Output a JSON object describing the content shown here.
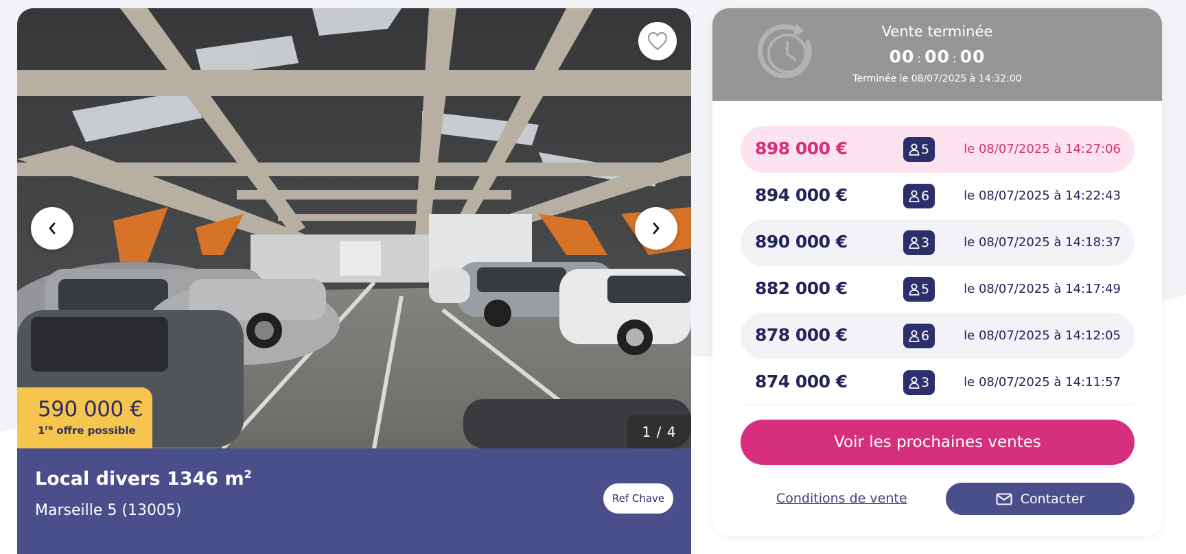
{
  "listing": {
    "price": "590 000 €",
    "offer_ord": "1",
    "offer_sup": "re",
    "offer_text": " offre possible",
    "counter": "1 / 4",
    "title": "Local divers 1346 m",
    "title_sup": "2",
    "address": "Marseille 5 (13005)",
    "ref_label": "Ref Chave"
  },
  "icons": {
    "favorite": "heart-outline-icon",
    "prev": "chevron-left-icon",
    "next": "chevron-right-icon",
    "clock": "clock-refresh-icon",
    "bidder": "person-icon",
    "mail": "envelope-icon"
  },
  "sale": {
    "status": "Vente terminée",
    "hours": "00",
    "minutes": "00",
    "seconds": "00",
    "ended_at": "Terminée le 08/07/2025 à 14:32:00",
    "bids": [
      {
        "amount": "898 000 €",
        "bidders": "5",
        "time": "le 08/07/2025 à 14:27:06"
      },
      {
        "amount": "894 000 €",
        "bidders": "6",
        "time": "le 08/07/2025 à 14:22:43"
      },
      {
        "amount": "890 000 €",
        "bidders": "3",
        "time": "le 08/07/2025 à 14:18:37"
      },
      {
        "amount": "882 000 €",
        "bidders": "5",
        "time": "le 08/07/2025 à 14:17:49"
      },
      {
        "amount": "878 000 €",
        "bidders": "6",
        "time": "le 08/07/2025 à 14:12:05"
      },
      {
        "amount": "874 000 €",
        "bidders": "3",
        "time": "le 08/07/2025 à 14:11:57"
      }
    ],
    "cta_label": "Voir les prochaines ventes",
    "conditions_label": "Conditions de vente",
    "contact_label": "Contacter"
  },
  "colors": {
    "navy": "#22245a",
    "band": "#4a4e8b",
    "pink": "#d62f7d",
    "pink_light": "#fce3ef",
    "yellow": "#f5c54e",
    "header_grey": "#959795"
  }
}
